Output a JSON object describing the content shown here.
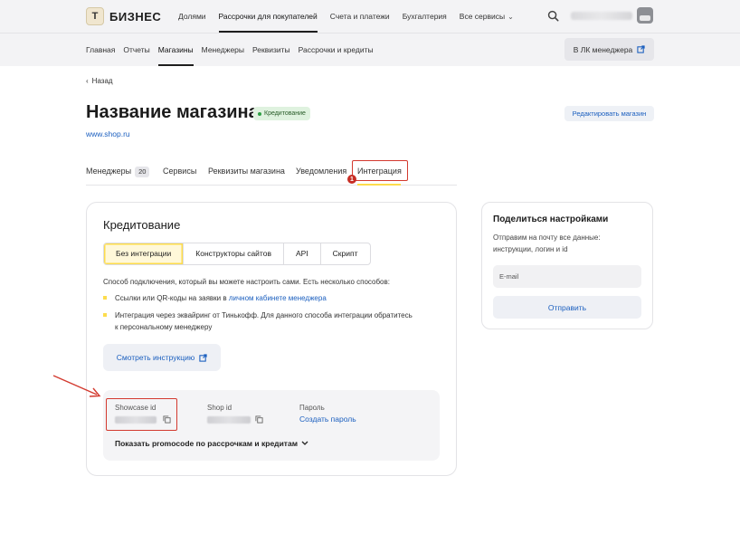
{
  "header": {
    "logo_letter": "Т",
    "logo_text": "БИЗНЕС",
    "nav": [
      {
        "label": "Долями"
      },
      {
        "label": "Рассрочки для покупателей"
      },
      {
        "label": "Счета и платежи"
      },
      {
        "label": "Бухгалтерия"
      },
      {
        "label": "Все сервисы"
      }
    ]
  },
  "subnav": {
    "items": [
      {
        "label": "Главная"
      },
      {
        "label": "Отчеты"
      },
      {
        "label": "Магазины"
      },
      {
        "label": "Менеджеры"
      },
      {
        "label": "Реквизиты"
      },
      {
        "label": "Рассрочки и кредиты"
      }
    ],
    "manager_button": "В ЛК менеджера"
  },
  "page": {
    "back": "Назад",
    "title": "Название магазина",
    "status_badge": "Кредитование",
    "site": "www.shop.ru",
    "edit_button": "Редактировать магазин"
  },
  "tabs": [
    {
      "label": "Менеджеры",
      "count": "20"
    },
    {
      "label": "Сервисы"
    },
    {
      "label": "Реквизиты магазина"
    },
    {
      "label": "Уведомления"
    },
    {
      "label": "Интеграция"
    }
  ],
  "marker_number": "1",
  "credit": {
    "title": "Кредитование",
    "options": [
      "Без интеграции",
      "Конструкторы сайтов",
      "API",
      "Скрипт"
    ],
    "description": "Способ подключения, который вы можете настроить сами. Есть несколько способов:",
    "bullet1_text": "Ссылки или QR-коды на заявки в ",
    "bullet1_link": "личном кабинете менеджера",
    "bullet2_line1": "Интеграция через эквайринг от Тинькофф. Для данного способа интеграции обратитесь",
    "bullet2_line2": "к персональному менеджеру",
    "instruction_button": "Смотреть инструкцию",
    "showcase_label": "Showcase id",
    "shop_label": "Shop id",
    "password_label": "Пароль",
    "create_password": "Создать пароль",
    "promo": "Показать promocode по рассрочкам и кредитам"
  },
  "share": {
    "title": "Поделиться настройками",
    "desc_line1": "Отправим на почту все данные:",
    "desc_line2": "инструкции, логин и id",
    "email_placeholder": "E-mail",
    "send_button": "Отправить"
  },
  "colors": {
    "accent_yellow": "#fddc4d",
    "link_blue": "#1b5fbf",
    "highlight_red": "#d33a2f"
  }
}
